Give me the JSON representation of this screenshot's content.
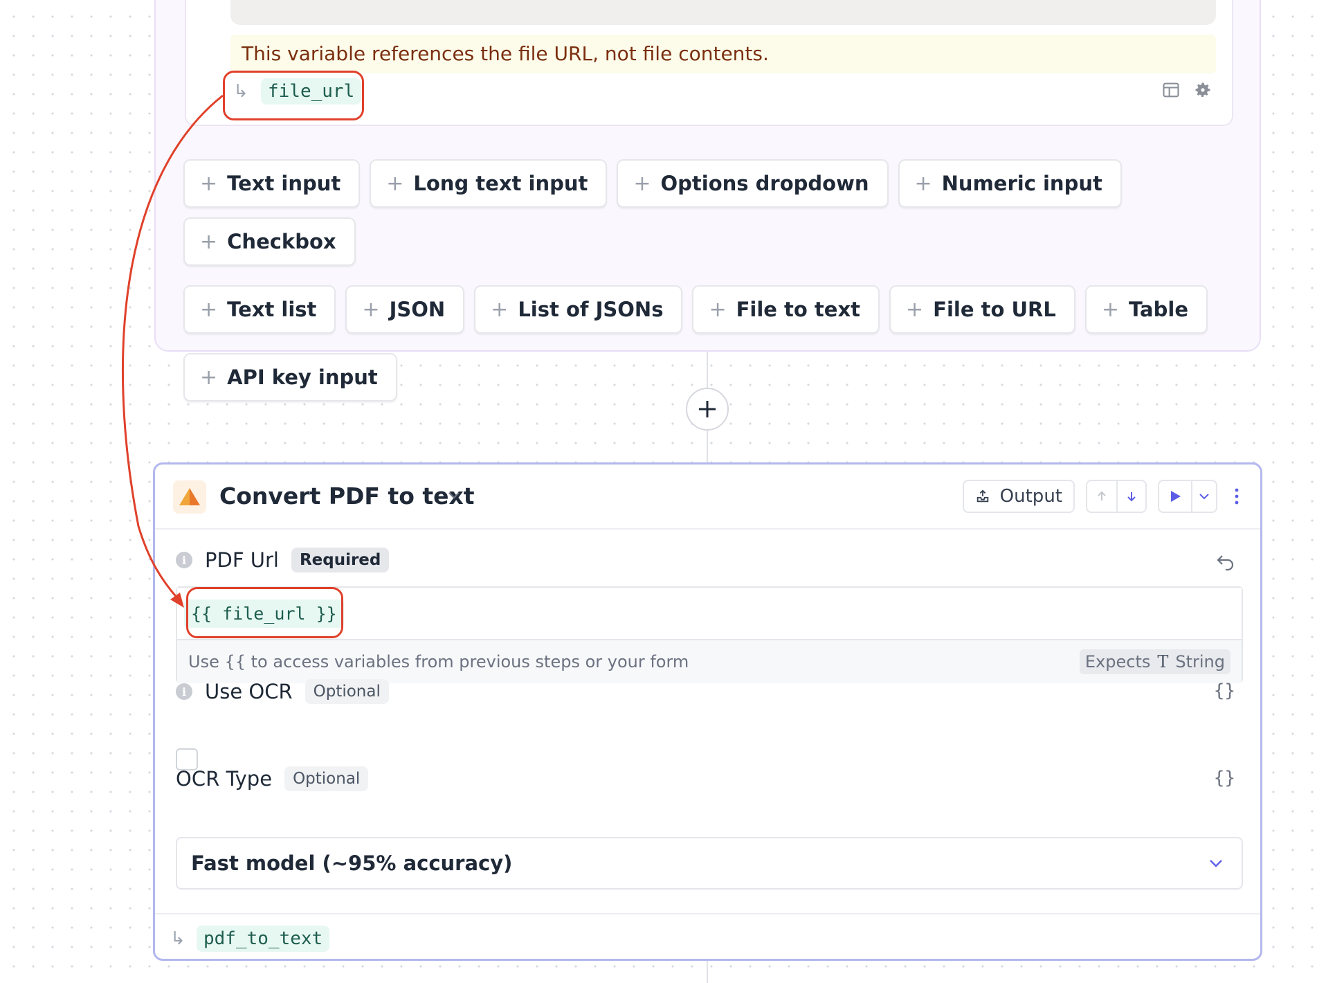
{
  "form": {
    "warning": "This variable references the file URL, not file contents.",
    "variable_name": "file_url",
    "add_buttons": [
      "Text input",
      "Long text input",
      "Options dropdown",
      "Numeric input",
      "Checkbox",
      "Text list",
      "JSON",
      "List of JSONs",
      "File to text",
      "File to URL",
      "Table",
      "API key input"
    ],
    "add_plus": "+"
  },
  "step": {
    "title": "Convert PDF to text",
    "output_label": "Output",
    "pdf_url": {
      "label": "PDF Url",
      "badge": "Required",
      "value": "{{ file_url }}",
      "help": "Use {{ to access variables from previous steps or your form",
      "expects_label": "Expects",
      "expects_type": "String",
      "type_glyph": "T"
    },
    "use_ocr": {
      "label": "Use OCR",
      "badge": "Optional",
      "checked": false
    },
    "ocr_type": {
      "label": "OCR Type",
      "badge": "Optional",
      "value": "Fast model (~95% accuracy)"
    },
    "output_variable": "pdf_to_text",
    "braces_glyph": "{}"
  },
  "colors": {
    "accent": "#5b5ce6",
    "annotation": "#e0412b",
    "variable_chip_bg": "#e7f8f2"
  },
  "icons": {
    "return": "↳",
    "info": "i"
  }
}
